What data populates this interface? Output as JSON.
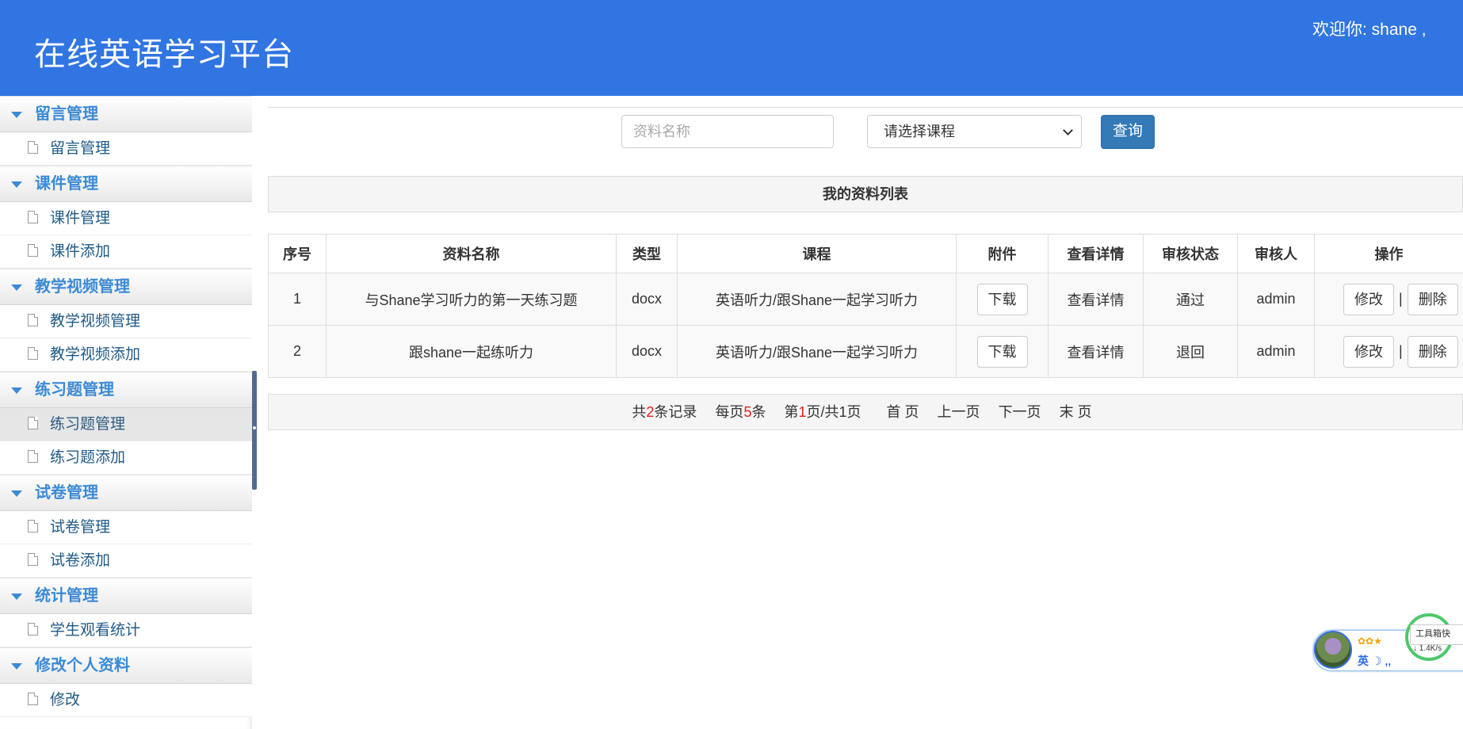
{
  "header": {
    "title": "在线英语学习平台",
    "welcome": "欢迎你: shane ,"
  },
  "sidebar": {
    "groups": [
      {
        "label": "留言管理",
        "items": [
          "留言管理"
        ]
      },
      {
        "label": "课件管理",
        "items": [
          "课件管理",
          "课件添加"
        ]
      },
      {
        "label": "教学视频管理",
        "items": [
          "教学视频管理",
          "教学视频添加"
        ]
      },
      {
        "label": "练习题管理",
        "items": [
          "练习题管理",
          "练习题添加"
        ]
      },
      {
        "label": "试卷管理",
        "items": [
          "试卷管理",
          "试卷添加"
        ]
      },
      {
        "label": "统计管理",
        "items": [
          "学生观看统计"
        ]
      },
      {
        "label": "修改个人资料",
        "items": [
          "修改"
        ]
      }
    ],
    "active_item": "练习题管理"
  },
  "search": {
    "name_placeholder": "资料名称",
    "course_selected": "请选择课程",
    "query_label": "查询"
  },
  "list_title": "我的资料列表",
  "table": {
    "headers": [
      "序号",
      "资料名称",
      "类型",
      "课程",
      "附件",
      "查看详情",
      "审核状态",
      "审核人",
      "操作"
    ],
    "rows": [
      {
        "no": "1",
        "name": "与Shane学习听力的第一天练习题",
        "type": "docx",
        "course": "英语听力/跟Shane一起学习听力",
        "attachment": "下载",
        "detail": "查看详情",
        "status": "通过",
        "reviewer": "admin",
        "edit": "修改",
        "delete": "删除"
      },
      {
        "no": "2",
        "name": "跟shane一起练听力",
        "type": "docx",
        "course": "英语听力/跟Shane一起学习听力",
        "attachment": "下载",
        "detail": "查看详情",
        "status": "退回",
        "reviewer": "admin",
        "edit": "修改",
        "delete": "删除"
      }
    ],
    "separator": "|"
  },
  "pager": {
    "total_prefix": "共",
    "total": "2",
    "total_suffix": "条记录",
    "per_page_prefix": "每页",
    "per_page": "5",
    "per_page_suffix": "条",
    "page_prefix": "第",
    "page": "1",
    "page_suffix": "页/共1页",
    "first": "首 页",
    "prev": "上一页",
    "next": "下一页",
    "last": "末 页"
  },
  "widget": {
    "stars": "✿✿★",
    "ime": "英 ☽ ‚‚",
    "tip": "工具箱快",
    "speed": "↓ 1.4K/s"
  },
  "colors": {
    "header_bg": "#3075e2",
    "sidebar_group_text": "#3b8ad6",
    "primary_button": "#337ab7",
    "pager_number": "#e02020"
  }
}
